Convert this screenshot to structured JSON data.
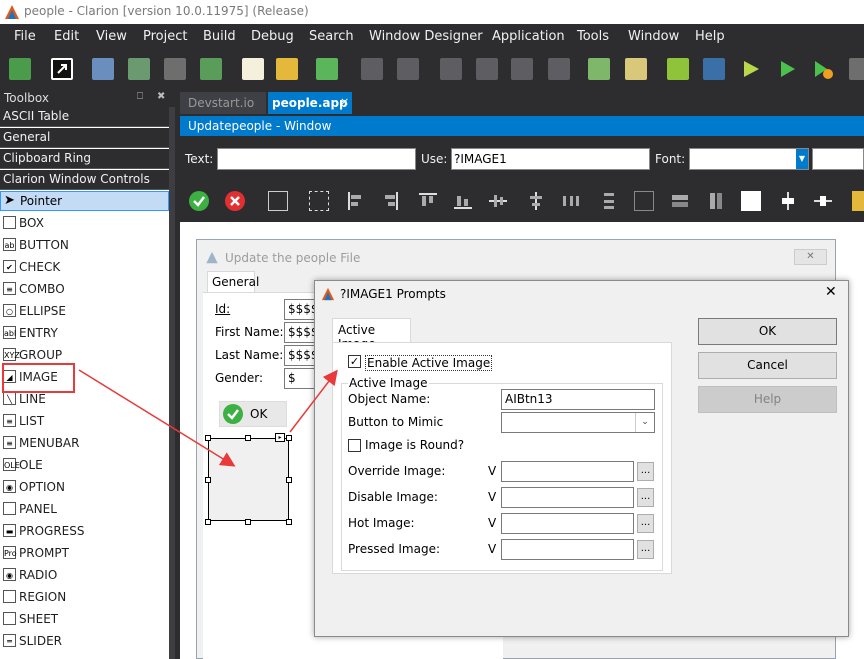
{
  "app": {
    "title": "people - Clarion [version 10.0.11975] (Release)",
    "logo_color": "#e05a1a"
  },
  "menu": [
    "File",
    "Edit",
    "View",
    "Project",
    "Build",
    "Debug",
    "Search",
    "Window Designer",
    "Application",
    "Tools",
    "Window",
    "Help"
  ],
  "toolbox": {
    "title": "Toolbox",
    "pin_glyph": "⎕",
    "close_glyph": "✖",
    "categories": [
      "ASCII Table",
      "General",
      "Clipboard Ring",
      "Clarion Window Controls"
    ],
    "pointer": "Pointer",
    "items": [
      {
        "label": "BOX",
        "icon": ""
      },
      {
        "label": "BUTTON",
        "icon": "ab"
      },
      {
        "label": "CHECK",
        "icon": "✔"
      },
      {
        "label": "COMBO",
        "icon": "≡"
      },
      {
        "label": "ELLIPSE",
        "icon": "○"
      },
      {
        "label": "ENTRY",
        "icon": "abl"
      },
      {
        "label": "GROUP",
        "icon": "XYZ"
      },
      {
        "label": "IMAGE",
        "icon": "◢"
      },
      {
        "label": "LINE",
        "icon": "╲"
      },
      {
        "label": "LIST",
        "icon": "≡"
      },
      {
        "label": "MENUBAR",
        "icon": "≡"
      },
      {
        "label": "OLE",
        "icon": "OLE"
      },
      {
        "label": "OPTION",
        "icon": "◉"
      },
      {
        "label": "PANEL",
        "icon": ""
      },
      {
        "label": "PROGRESS",
        "icon": "▬"
      },
      {
        "label": "PROMPT",
        "icon": "Pro"
      },
      {
        "label": "RADIO",
        "icon": "◉"
      },
      {
        "label": "REGION",
        "icon": ""
      },
      {
        "label": "SHEET",
        "icon": ""
      },
      {
        "label": "SLIDER",
        "icon": "═"
      }
    ]
  },
  "tabs": [
    {
      "label": "Devstart.io",
      "active": false
    },
    {
      "label": "people.app",
      "active": true,
      "close": "×"
    }
  ],
  "designer": {
    "title": "Updatepeople - Window",
    "text_label": "Text:",
    "text_value": "",
    "use_label": "Use:",
    "use_value": "?IMAGE1",
    "font_label": "Font:",
    "font_value": ""
  },
  "design_window": {
    "title": "Update the people File",
    "tab": "General",
    "fields": [
      {
        "label": "Id:",
        "value": "$$$$"
      },
      {
        "label": "First Name:",
        "value": "$$$$"
      },
      {
        "label": "Last Name:",
        "value": "$$$$"
      },
      {
        "label": "Gender:",
        "value": "$"
      }
    ],
    "ok_label": "OK"
  },
  "dialog": {
    "title": "?IMAGE1 Prompts",
    "tab": "Active Image",
    "enable_label": "Enable Active Image",
    "enable_checked": true,
    "group_title": "Active Image",
    "object_name_label": "Object Name:",
    "object_name_value": "AIBtn13",
    "mimic_label": "Button to Mimic",
    "mimic_value": "",
    "round_label": "Image is Round?",
    "round_checked": false,
    "images": [
      {
        "label": "Override Image:",
        "v": "V",
        "value": ""
      },
      {
        "label": "Disable Image:",
        "v": "V",
        "value": ""
      },
      {
        "label": "Hot Image:",
        "v": "V",
        "value": ""
      },
      {
        "label": "Pressed Image:",
        "v": "V",
        "value": ""
      }
    ],
    "browse": "...",
    "ok": "OK",
    "cancel": "Cancel",
    "help": "Help",
    "close_glyph": "✕"
  },
  "colors": {
    "accent": "#007acc",
    "annotation": "#e83a3a",
    "ide_dark": "#2d2d30"
  }
}
